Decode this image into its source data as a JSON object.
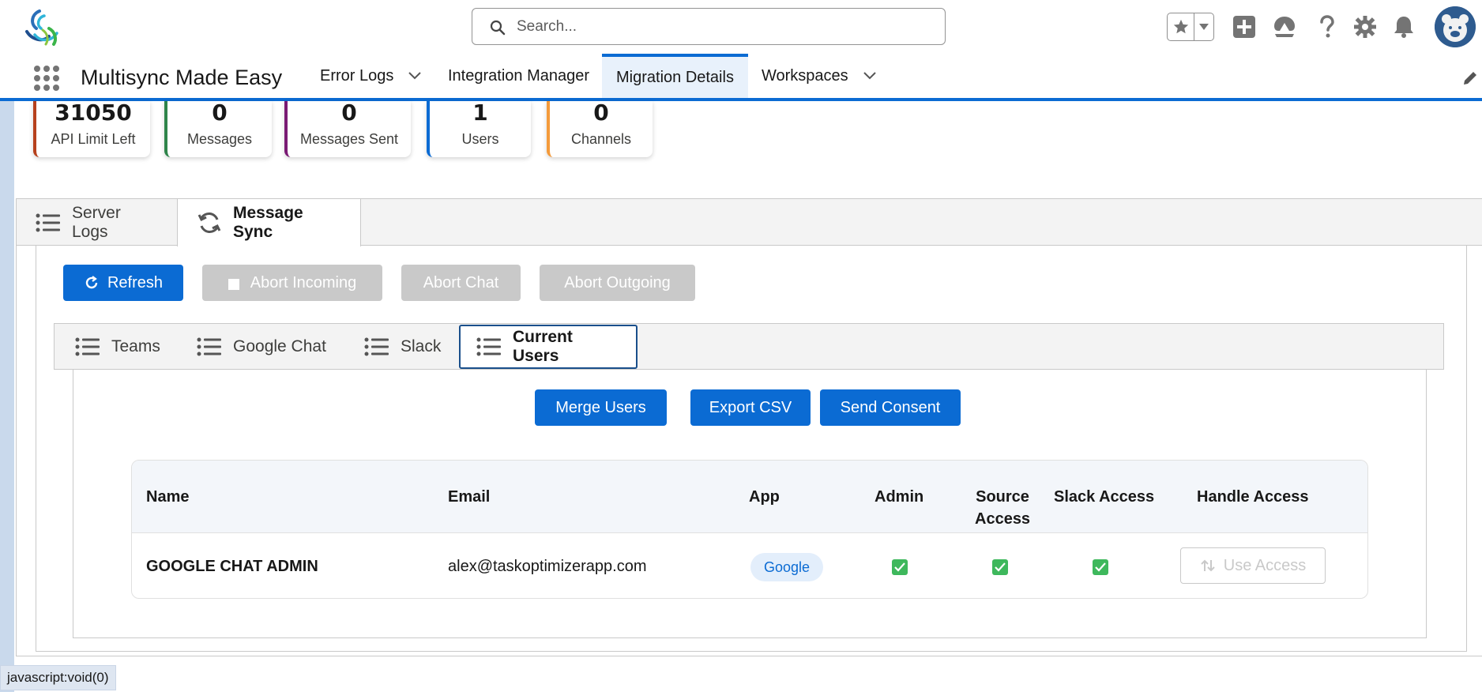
{
  "header": {
    "search_placeholder": "Search...",
    "icons": [
      "favorites-star-icon",
      "caret-down-icon",
      "add-icon",
      "trailhead-icon",
      "help-icon",
      "setup-gear-icon",
      "notifications-bell-icon",
      "avatar"
    ]
  },
  "nav": {
    "app_name": "Multisync Made Easy",
    "items": [
      {
        "label": "Error Logs",
        "has_menu": true,
        "active": false
      },
      {
        "label": "Integration Manager",
        "has_menu": false,
        "active": false
      },
      {
        "label": "Migration Details",
        "has_menu": false,
        "active": true
      },
      {
        "label": "Workspaces",
        "has_menu": true,
        "active": false
      }
    ]
  },
  "stats": [
    {
      "value": "31050",
      "label": "API Limit Left",
      "color": "#b6411d"
    },
    {
      "value": "0",
      "label": "Messages",
      "color": "#2e844a"
    },
    {
      "value": "0",
      "label": "Messages Sent",
      "color": "#7a1a74"
    },
    {
      "value": "1",
      "label": "Users",
      "color": "#0b6bd3"
    },
    {
      "value": "0",
      "label": "Channels",
      "color": "#f49a3a"
    }
  ],
  "sync_tabs": [
    {
      "label": "Server Logs",
      "active": false
    },
    {
      "label": "Message Sync",
      "active": true
    }
  ],
  "actions": {
    "refresh": "Refresh",
    "abort_incoming": "Abort Incoming",
    "abort_chat": "Abort Chat",
    "abort_outgoing": "Abort Outgoing"
  },
  "sub_tabs": [
    {
      "label": "Teams",
      "active": false
    },
    {
      "label": "Google Chat",
      "active": false
    },
    {
      "label": "Slack",
      "active": false
    },
    {
      "label": "Current Users",
      "active": true
    }
  ],
  "user_actions": {
    "merge_users": "Merge Users",
    "export_csv": "Export CSV",
    "send_consent": "Send Consent"
  },
  "users_table": {
    "columns": {
      "name": "Name",
      "email": "Email",
      "app": "App",
      "admin": "Admin",
      "source_access_1": "Source",
      "source_access_2": "Access",
      "slack_access": "Slack Access",
      "handle_access": "Handle Access"
    },
    "rows": [
      {
        "name": "GOOGLE CHAT ADMIN",
        "email": "alex@taskoptimizerapp.com",
        "app": "Google",
        "admin": true,
        "source_access": true,
        "slack_access": true,
        "handle_access_label": "Use Access"
      }
    ]
  },
  "status_bar": "javascript:void(0)",
  "colors": {
    "brand_blue": "#0b6bd3",
    "disabled_gray": "#c9c9c9",
    "check_green": "#3eb85c"
  }
}
